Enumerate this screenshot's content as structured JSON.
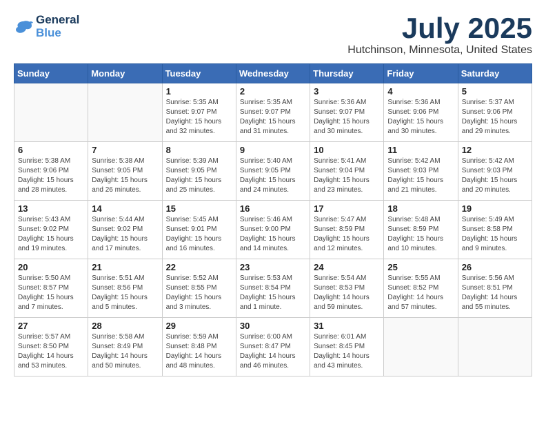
{
  "header": {
    "logo_line1": "General",
    "logo_line2": "Blue",
    "month": "July 2025",
    "location": "Hutchinson, Minnesota, United States"
  },
  "weekdays": [
    "Sunday",
    "Monday",
    "Tuesday",
    "Wednesday",
    "Thursday",
    "Friday",
    "Saturday"
  ],
  "weeks": [
    [
      {
        "day": "",
        "sunrise": "",
        "sunset": "",
        "daylight": ""
      },
      {
        "day": "",
        "sunrise": "",
        "sunset": "",
        "daylight": ""
      },
      {
        "day": "1",
        "sunrise": "Sunrise: 5:35 AM",
        "sunset": "Sunset: 9:07 PM",
        "daylight": "Daylight: 15 hours and 32 minutes."
      },
      {
        "day": "2",
        "sunrise": "Sunrise: 5:35 AM",
        "sunset": "Sunset: 9:07 PM",
        "daylight": "Daylight: 15 hours and 31 minutes."
      },
      {
        "day": "3",
        "sunrise": "Sunrise: 5:36 AM",
        "sunset": "Sunset: 9:07 PM",
        "daylight": "Daylight: 15 hours and 30 minutes."
      },
      {
        "day": "4",
        "sunrise": "Sunrise: 5:36 AM",
        "sunset": "Sunset: 9:06 PM",
        "daylight": "Daylight: 15 hours and 30 minutes."
      },
      {
        "day": "5",
        "sunrise": "Sunrise: 5:37 AM",
        "sunset": "Sunset: 9:06 PM",
        "daylight": "Daylight: 15 hours and 29 minutes."
      }
    ],
    [
      {
        "day": "6",
        "sunrise": "Sunrise: 5:38 AM",
        "sunset": "Sunset: 9:06 PM",
        "daylight": "Daylight: 15 hours and 28 minutes."
      },
      {
        "day": "7",
        "sunrise": "Sunrise: 5:38 AM",
        "sunset": "Sunset: 9:05 PM",
        "daylight": "Daylight: 15 hours and 26 minutes."
      },
      {
        "day": "8",
        "sunrise": "Sunrise: 5:39 AM",
        "sunset": "Sunset: 9:05 PM",
        "daylight": "Daylight: 15 hours and 25 minutes."
      },
      {
        "day": "9",
        "sunrise": "Sunrise: 5:40 AM",
        "sunset": "Sunset: 9:05 PM",
        "daylight": "Daylight: 15 hours and 24 minutes."
      },
      {
        "day": "10",
        "sunrise": "Sunrise: 5:41 AM",
        "sunset": "Sunset: 9:04 PM",
        "daylight": "Daylight: 15 hours and 23 minutes."
      },
      {
        "day": "11",
        "sunrise": "Sunrise: 5:42 AM",
        "sunset": "Sunset: 9:03 PM",
        "daylight": "Daylight: 15 hours and 21 minutes."
      },
      {
        "day": "12",
        "sunrise": "Sunrise: 5:42 AM",
        "sunset": "Sunset: 9:03 PM",
        "daylight": "Daylight: 15 hours and 20 minutes."
      }
    ],
    [
      {
        "day": "13",
        "sunrise": "Sunrise: 5:43 AM",
        "sunset": "Sunset: 9:02 PM",
        "daylight": "Daylight: 15 hours and 19 minutes."
      },
      {
        "day": "14",
        "sunrise": "Sunrise: 5:44 AM",
        "sunset": "Sunset: 9:02 PM",
        "daylight": "Daylight: 15 hours and 17 minutes."
      },
      {
        "day": "15",
        "sunrise": "Sunrise: 5:45 AM",
        "sunset": "Sunset: 9:01 PM",
        "daylight": "Daylight: 15 hours and 16 minutes."
      },
      {
        "day": "16",
        "sunrise": "Sunrise: 5:46 AM",
        "sunset": "Sunset: 9:00 PM",
        "daylight": "Daylight: 15 hours and 14 minutes."
      },
      {
        "day": "17",
        "sunrise": "Sunrise: 5:47 AM",
        "sunset": "Sunset: 8:59 PM",
        "daylight": "Daylight: 15 hours and 12 minutes."
      },
      {
        "day": "18",
        "sunrise": "Sunrise: 5:48 AM",
        "sunset": "Sunset: 8:59 PM",
        "daylight": "Daylight: 15 hours and 10 minutes."
      },
      {
        "day": "19",
        "sunrise": "Sunrise: 5:49 AM",
        "sunset": "Sunset: 8:58 PM",
        "daylight": "Daylight: 15 hours and 9 minutes."
      }
    ],
    [
      {
        "day": "20",
        "sunrise": "Sunrise: 5:50 AM",
        "sunset": "Sunset: 8:57 PM",
        "daylight": "Daylight: 15 hours and 7 minutes."
      },
      {
        "day": "21",
        "sunrise": "Sunrise: 5:51 AM",
        "sunset": "Sunset: 8:56 PM",
        "daylight": "Daylight: 15 hours and 5 minutes."
      },
      {
        "day": "22",
        "sunrise": "Sunrise: 5:52 AM",
        "sunset": "Sunset: 8:55 PM",
        "daylight": "Daylight: 15 hours and 3 minutes."
      },
      {
        "day": "23",
        "sunrise": "Sunrise: 5:53 AM",
        "sunset": "Sunset: 8:54 PM",
        "daylight": "Daylight: 15 hours and 1 minute."
      },
      {
        "day": "24",
        "sunrise": "Sunrise: 5:54 AM",
        "sunset": "Sunset: 8:53 PM",
        "daylight": "Daylight: 14 hours and 59 minutes."
      },
      {
        "day": "25",
        "sunrise": "Sunrise: 5:55 AM",
        "sunset": "Sunset: 8:52 PM",
        "daylight": "Daylight: 14 hours and 57 minutes."
      },
      {
        "day": "26",
        "sunrise": "Sunrise: 5:56 AM",
        "sunset": "Sunset: 8:51 PM",
        "daylight": "Daylight: 14 hours and 55 minutes."
      }
    ],
    [
      {
        "day": "27",
        "sunrise": "Sunrise: 5:57 AM",
        "sunset": "Sunset: 8:50 PM",
        "daylight": "Daylight: 14 hours and 53 minutes."
      },
      {
        "day": "28",
        "sunrise": "Sunrise: 5:58 AM",
        "sunset": "Sunset: 8:49 PM",
        "daylight": "Daylight: 14 hours and 50 minutes."
      },
      {
        "day": "29",
        "sunrise": "Sunrise: 5:59 AM",
        "sunset": "Sunset: 8:48 PM",
        "daylight": "Daylight: 14 hours and 48 minutes."
      },
      {
        "day": "30",
        "sunrise": "Sunrise: 6:00 AM",
        "sunset": "Sunset: 8:47 PM",
        "daylight": "Daylight: 14 hours and 46 minutes."
      },
      {
        "day": "31",
        "sunrise": "Sunrise: 6:01 AM",
        "sunset": "Sunset: 8:45 PM",
        "daylight": "Daylight: 14 hours and 43 minutes."
      },
      {
        "day": "",
        "sunrise": "",
        "sunset": "",
        "daylight": ""
      },
      {
        "day": "",
        "sunrise": "",
        "sunset": "",
        "daylight": ""
      }
    ]
  ]
}
